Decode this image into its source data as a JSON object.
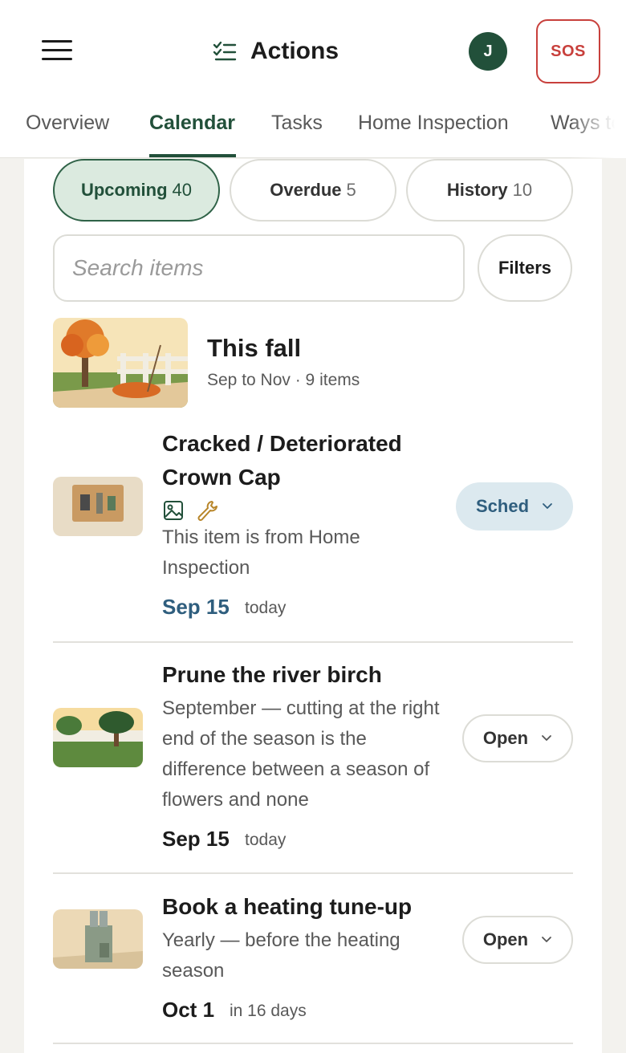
{
  "header": {
    "title": "Actions",
    "avatar_initial": "J",
    "sos_label": "SOS"
  },
  "tabs": [
    {
      "label": "Overview",
      "active": false
    },
    {
      "label": "Calendar",
      "active": true
    },
    {
      "label": "Tasks",
      "active": false
    },
    {
      "label": "Home Inspection",
      "active": false
    },
    {
      "label": "Ways to",
      "active": false
    }
  ],
  "filters_row": {
    "pills": [
      {
        "label": "Upcoming",
        "count": "40",
        "active": true
      },
      {
        "label": "Overdue",
        "count": "5",
        "active": false
      },
      {
        "label": "History",
        "count": "10",
        "active": false
      }
    ],
    "search_placeholder": "Search items",
    "filters_label": "Filters"
  },
  "season": {
    "title": "This fall",
    "subtitle": "Sep to Nov · 9 items"
  },
  "items": [
    {
      "title": "Cracked / Deteriorated Crown Cap",
      "badges": [
        "image-icon",
        "wrench-icon"
      ],
      "description": "This item is from Home Inspection",
      "date": "Sep 15",
      "relative": "today",
      "status": "Sched"
    },
    {
      "title": "Prune the river birch",
      "description": "September — cutting at the right end of the season is the difference between a season of flowers and none",
      "date": "Sep 15",
      "relative": "today",
      "status": "Open"
    },
    {
      "title": "Book a heating tune-up",
      "description": "Yearly — before the heating season",
      "date": "Oct 1",
      "relative": "in 16 days",
      "status": "Open"
    }
  ],
  "colors": {
    "brand_green": "#22503a",
    "active_pill_bg": "#dbeadf",
    "sched_bg": "#dce9ef",
    "sched_text": "#2f5e7e",
    "sos_red": "#c8403c",
    "page_bg": "#f3f2ee"
  }
}
